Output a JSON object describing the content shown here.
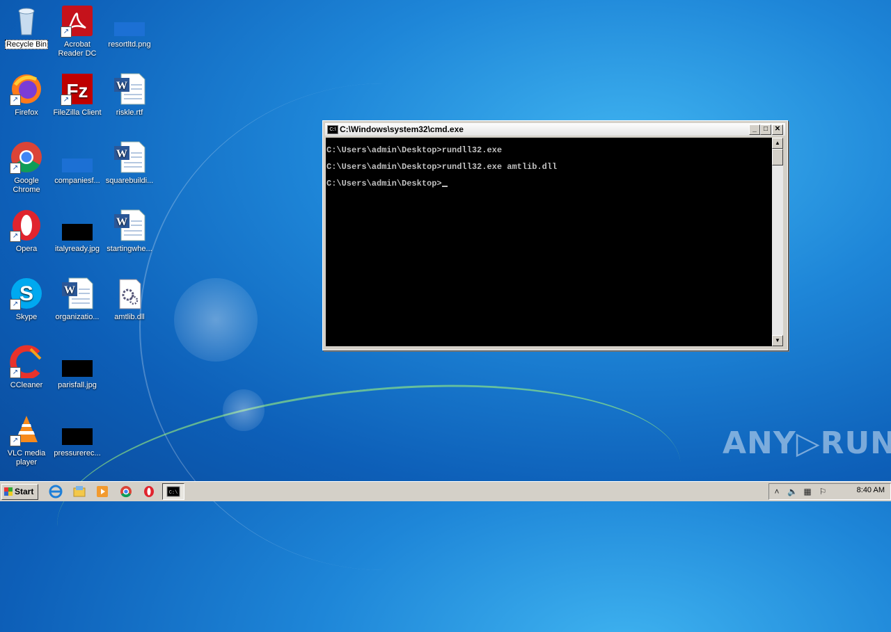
{
  "desktop": {
    "icons": [
      {
        "label": "Recycle Bin"
      },
      {
        "label": "Acrobat Reader DC"
      },
      {
        "label": "resortltd.png"
      },
      {
        "label": "Firefox"
      },
      {
        "label": "FileZilla Client"
      },
      {
        "label": "riskle.rtf"
      },
      {
        "label": "Google Chrome"
      },
      {
        "label": "companiesf..."
      },
      {
        "label": "squarebuildi..."
      },
      {
        "label": "Opera"
      },
      {
        "label": "italyready.jpg"
      },
      {
        "label": "startingwhe..."
      },
      {
        "label": "Skype"
      },
      {
        "label": "organizatio..."
      },
      {
        "label": "amtlib.dll"
      },
      {
        "label": "CCleaner"
      },
      {
        "label": "parisfall.jpg"
      },
      {
        "label": "VLC media player"
      },
      {
        "label": "pressurerec..."
      }
    ]
  },
  "cmd_window": {
    "title": "C:\\Windows\\system32\\cmd.exe",
    "icon_text": "C:\\",
    "lines": [
      "C:\\Users\\admin\\Desktop>rundll32.exe",
      "C:\\Users\\admin\\Desktop>rundll32.exe amtlib.dll",
      "C:\\Users\\admin\\Desktop>"
    ],
    "minimize": "_",
    "maximize": "□",
    "close": "✕"
  },
  "taskbar": {
    "start_label": "Start",
    "clock": "8:40 AM",
    "pinned": [
      "ie-icon",
      "explorer-icon",
      "media-player-icon",
      "chrome-icon",
      "opera-icon",
      "cmd-icon"
    ],
    "tray": [
      "show-hidden-icon",
      "volume-icon",
      "network-icon",
      "flag-icon"
    ]
  },
  "watermark": "ANY▷RUN"
}
